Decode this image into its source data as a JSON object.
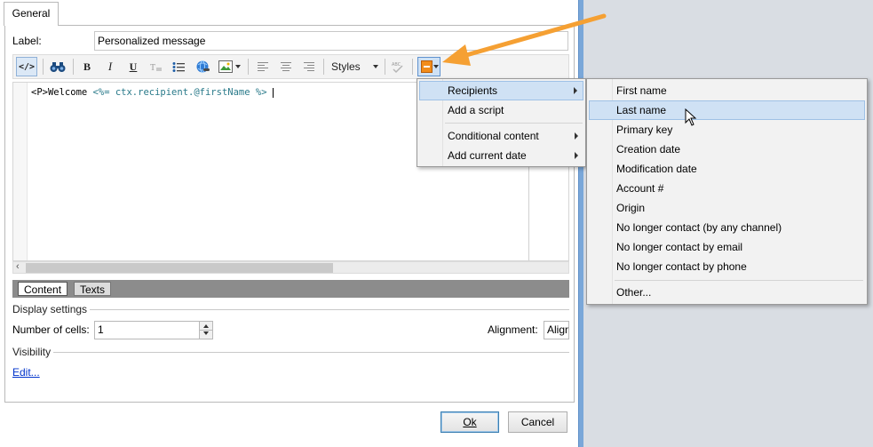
{
  "tabs": {
    "general": "General"
  },
  "label_field": {
    "label": "Label:",
    "value": "Personalized message"
  },
  "toolbar": {
    "styles": "Styles",
    "bold": "B",
    "italic": "I",
    "underline": "U"
  },
  "editor": {
    "tag": "<P>Welcome ",
    "script": "<%= ctx.recipient.@firstName %>"
  },
  "lower_tabs": {
    "content": "Content",
    "texts": "Texts"
  },
  "display": {
    "section": "Display settings",
    "cells_label": "Number of cells:",
    "cells_value": "1",
    "alignment_label": "Alignment:",
    "alignment_value": "Align"
  },
  "visibility": {
    "section": "Visibility",
    "edit_link": "Edit..."
  },
  "buttons": {
    "ok": "Ok",
    "cancel": "Cancel"
  },
  "menu": {
    "items": [
      "Recipients",
      "Add a script",
      "Conditional content",
      "Add current date"
    ]
  },
  "submenu": {
    "items": [
      "First name",
      "Last name",
      "Primary key",
      "Creation date",
      "Modification date",
      "Account #",
      "Origin",
      "No longer contact (by any channel)",
      "No longer contact by email",
      "No longer contact by phone",
      "Other..."
    ]
  },
  "colors": {
    "annotation_arrow": "#f5a033",
    "highlight": "#cfe1f4",
    "script_text": "#2a7a8a",
    "link": "#0033cc"
  }
}
